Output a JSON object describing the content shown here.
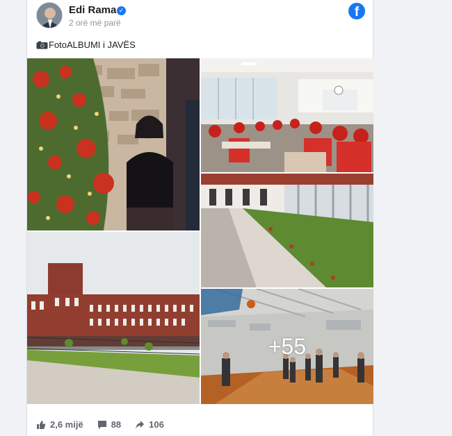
{
  "post": {
    "author": "Edi Rama",
    "timestamp": "2 orë më parë",
    "caption": "FotoALBUMI i JAVËS"
  },
  "gallery": {
    "more_count": "+55"
  },
  "stats": {
    "likes": "2,6 mijë",
    "comments": "88",
    "shares": "106"
  },
  "colors": {
    "brand": "#1877f2",
    "text": "#1c1e21",
    "muted": "#90949c"
  },
  "icons": [
    "verified-badge-icon",
    "facebook-logo-icon",
    "camera-icon",
    "like-icon",
    "comment-icon",
    "share-icon"
  ]
}
